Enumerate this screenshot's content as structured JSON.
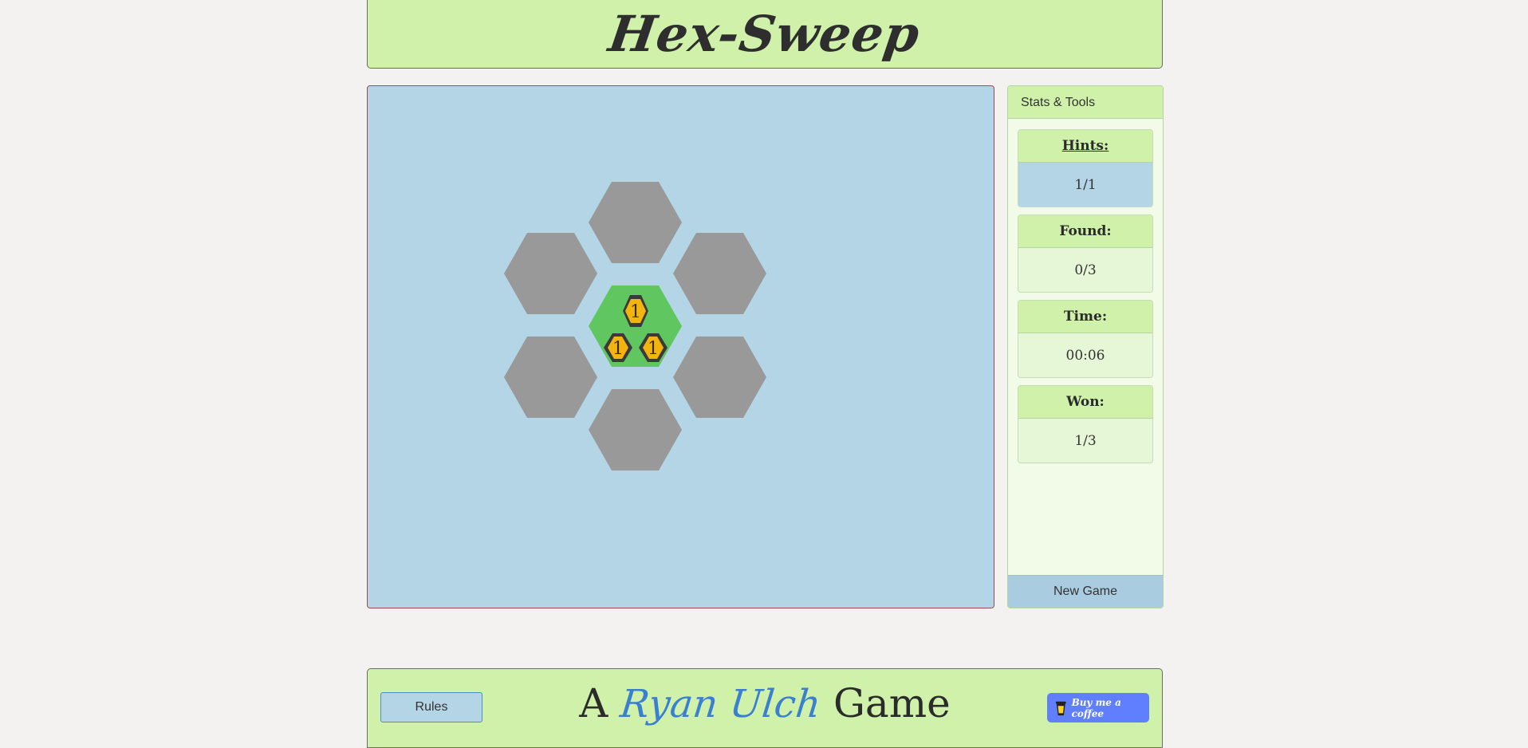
{
  "header": {
    "title": "Hex-Sweep"
  },
  "board": {
    "tiles": [
      {
        "id": "top",
        "state": "hidden"
      },
      {
        "id": "upper-left",
        "state": "hidden"
      },
      {
        "id": "upper-right",
        "state": "hidden"
      },
      {
        "id": "center",
        "state": "revealed",
        "clue_numbers": [
          "1",
          "1",
          "1"
        ]
      },
      {
        "id": "lower-left",
        "state": "hidden"
      },
      {
        "id": "lower-right",
        "state": "hidden"
      },
      {
        "id": "bottom",
        "state": "hidden"
      }
    ],
    "colors": {
      "hidden": "#999999",
      "revealed": "#60c660",
      "clue": "#f2b40f",
      "background": "#b4d5e6"
    }
  },
  "panel": {
    "title": "Stats & Tools",
    "hints": {
      "label": "Hints:",
      "value": "1/1"
    },
    "found": {
      "label": "Found:",
      "value": "0/3"
    },
    "time": {
      "label": "Time:",
      "value": "00:06"
    },
    "won": {
      "label": "Won:",
      "value": "1/3"
    },
    "new_game_label": "New Game"
  },
  "footer": {
    "rules_label": "Rules",
    "credit_prefix": "A",
    "credit_author": "Ryan Ulch",
    "credit_suffix": "Game",
    "coffee_label": "Buy me a coffee",
    "coffee_icon": "coffee-cup-icon"
  }
}
